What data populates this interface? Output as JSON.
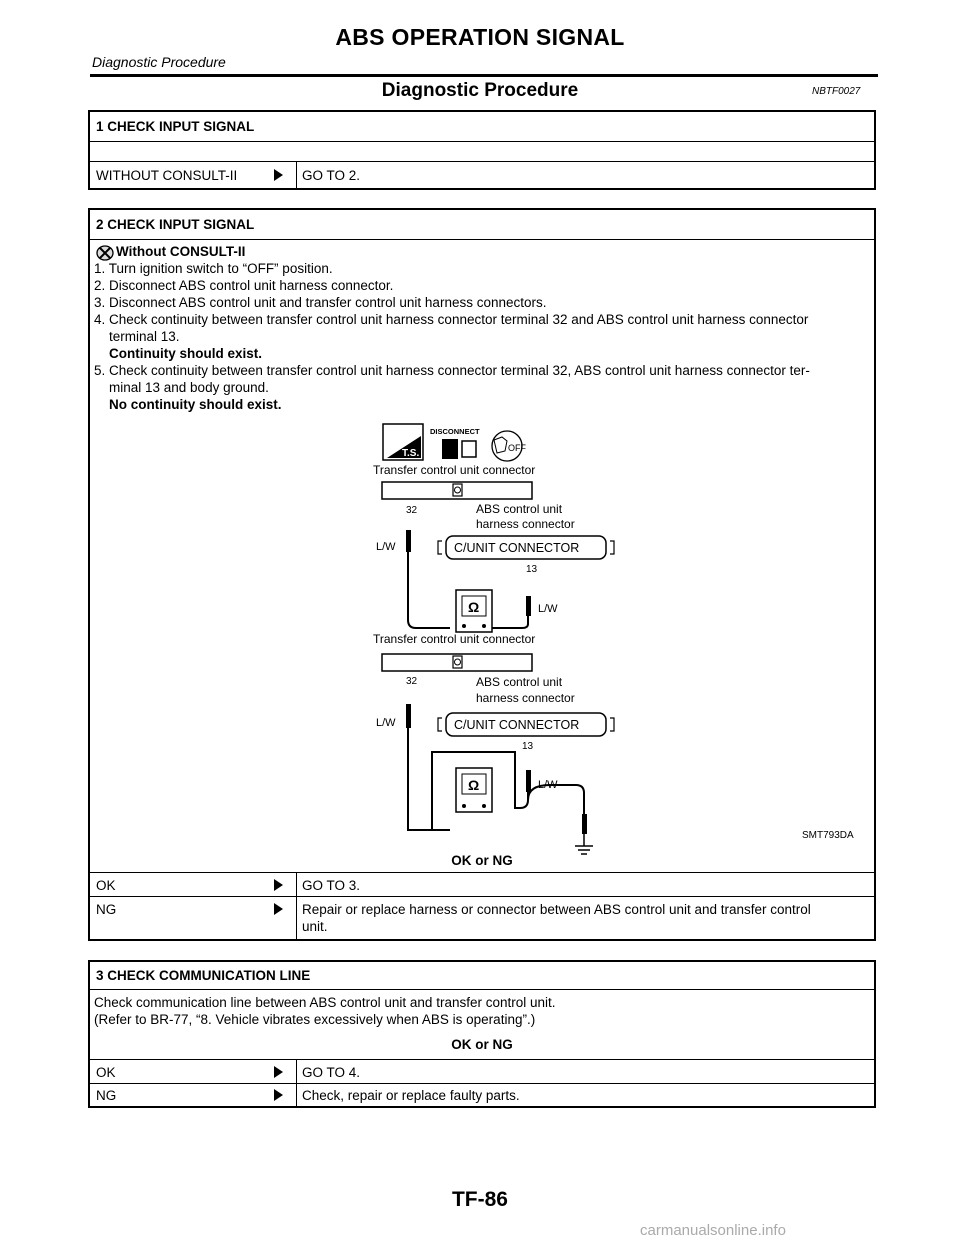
{
  "header": {
    "title": "ABS OPERATION SIGNAL",
    "subtitle": "Diagnostic Procedure"
  },
  "section": {
    "title": "Diagnostic Procedure",
    "ref": "NBTF0027"
  },
  "step1": {
    "heading": "1 CHECK INPUT SIGNAL",
    "row_label": "WITHOUT CONSULT-II",
    "row_result": "GO TO 2."
  },
  "step2": {
    "heading": "2 CHECK INPUT SIGNAL",
    "mode": "Without CONSULT-II",
    "lines": [
      "1. Turn ignition switch to “OFF” position.",
      "2. Disconnect ABS control unit harness connector.",
      "3. Disconnect ABS control unit and transfer control unit harness connectors.",
      "4. Check continuity between transfer control unit harness connector terminal 32 and ABS control unit harness connector",
      "terminal 13.",
      "Continuity should exist.",
      "5. Check continuity between transfer control unit harness connector terminal 32, ABS control unit harness connector ter-",
      "minal 13 and body ground.",
      "No continuity should exist."
    ],
    "diagram": {
      "icon_ts": "T.S.",
      "icon_disconnect": "DISCONNECT",
      "icon_off": "OFF",
      "transfer_label": "Transfer control unit connector",
      "abs_label_1": "ABS control unit",
      "abs_label_2": "harness connector",
      "cunit": "C/UNIT CONNECTOR",
      "term32": "32",
      "term13": "13",
      "wire": "L/W",
      "ohm": "Ω",
      "code": "SMT793DA"
    },
    "okng": "OK or NG",
    "ok_label": "OK",
    "ok_result": "GO TO 3.",
    "ng_label": "NG",
    "ng_result_1": "Repair or replace harness or connector between ABS control unit and transfer control",
    "ng_result_2": "unit."
  },
  "step3": {
    "heading": "3 CHECK COMMUNICATION LINE",
    "line1": "Check communication line between ABS control unit and transfer control unit.",
    "line2": "(Refer to BR-77, “8. Vehicle vibrates excessively when ABS is operating”.)",
    "okng": "OK or NG",
    "ok_label": "OK",
    "ok_result": "GO TO 4.",
    "ng_label": "NG",
    "ng_result": "Check, repair or replace faulty parts."
  },
  "footer": {
    "page": "TF-86",
    "watermark": "carmanualsonline.info"
  }
}
